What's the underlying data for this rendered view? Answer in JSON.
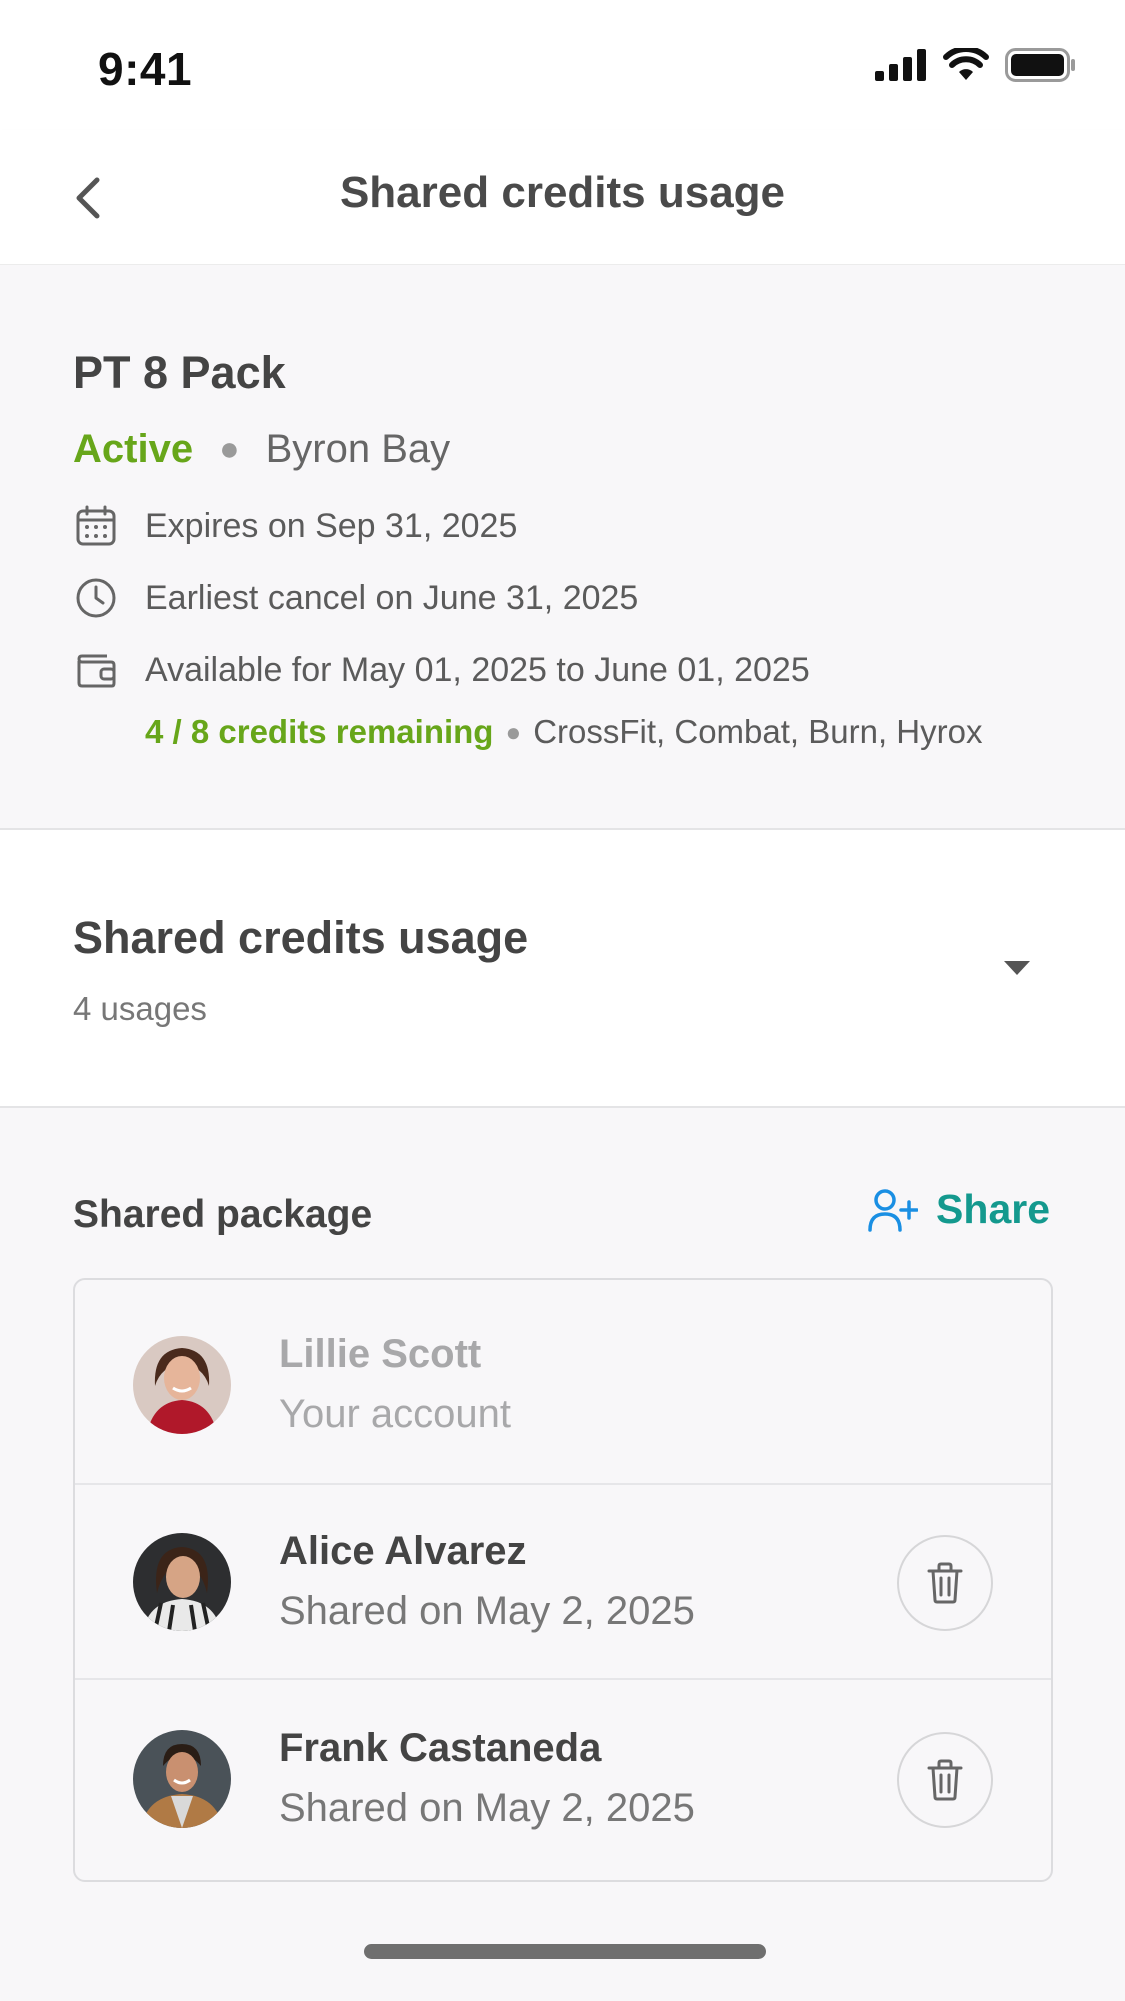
{
  "status_bar": {
    "time": "9:41"
  },
  "nav": {
    "title": "Shared credits usage"
  },
  "package": {
    "title": "PT 8 Pack",
    "status": "Active",
    "location": "Byron Bay",
    "expires": "Expires on Sep 31, 2025",
    "earliest_cancel": "Earliest cancel on June 31, 2025",
    "available": "Available for May 01, 2025 to June 01, 2025",
    "credits_remaining": "4 / 8 credits remaining",
    "activities": "CrossFit, Combat, Burn, Hyrox",
    "colors": {
      "active": "#67a61a"
    }
  },
  "usage": {
    "title": "Shared credits usage",
    "subtitle": "4 usages"
  },
  "shared": {
    "title": "Shared package",
    "share_label": "Share",
    "members": [
      {
        "name": "Lillie Scott",
        "subtitle": "Your account"
      },
      {
        "name": "Alice Alvarez",
        "subtitle": "Shared on May 2, 2025"
      },
      {
        "name": "Frank Castaneda",
        "subtitle": "Shared on May 2, 2025"
      }
    ],
    "colors": {
      "share": "#14998e"
    }
  }
}
